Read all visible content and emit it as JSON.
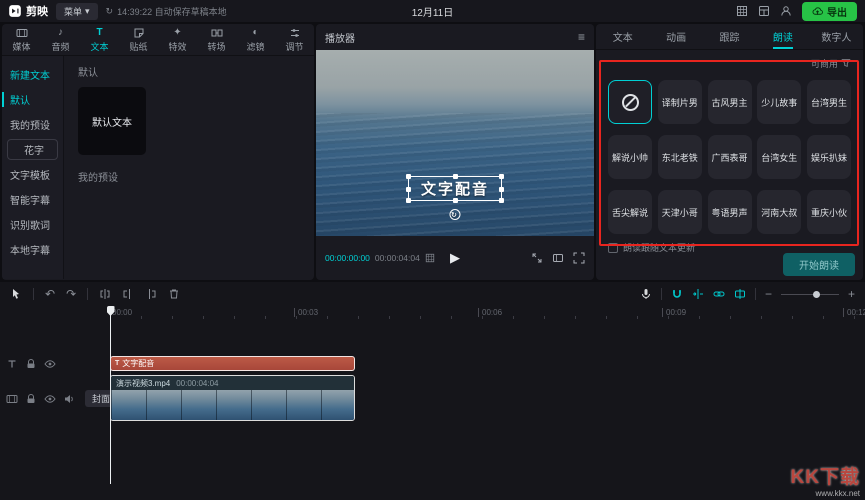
{
  "app": {
    "logo": "剪映",
    "menu_label": "菜单",
    "autosave": "14:39:22 自动保存草稿本地",
    "date": "12月11日",
    "export_label": "导出"
  },
  "left_tabs": [
    {
      "label": "媒体"
    },
    {
      "label": "音频"
    },
    {
      "label": "文本"
    },
    {
      "label": "贴纸"
    },
    {
      "label": "特效"
    },
    {
      "label": "转场"
    },
    {
      "label": "滤镜"
    },
    {
      "label": "调节"
    }
  ],
  "sidebar": {
    "items": [
      {
        "label": "新建文本"
      },
      {
        "label": "默认"
      },
      {
        "label": "我的预设"
      },
      {
        "label": "花字"
      },
      {
        "label": "文字模板"
      },
      {
        "label": "智能字幕"
      },
      {
        "label": "识别歌词"
      },
      {
        "label": "本地字幕"
      }
    ]
  },
  "library": {
    "section_default": "默认",
    "tile_label": "默认文本",
    "section_presets": "我的预设"
  },
  "player": {
    "title": "播放器",
    "overlay_text": "文字配音",
    "current_time": "00:00:00:00",
    "duration": "00:00:04:04"
  },
  "reader": {
    "tabs": [
      {
        "label": "文本"
      },
      {
        "label": "动画"
      },
      {
        "label": "跟踪"
      },
      {
        "label": "朗读"
      },
      {
        "label": "数字人"
      }
    ],
    "filter_label": "可商用",
    "voices": [
      {
        "name": ""
      },
      {
        "name": "译制片男"
      },
      {
        "name": "古风男主"
      },
      {
        "name": "少儿故事"
      },
      {
        "name": "台湾男生"
      },
      {
        "name": "解说小帅"
      },
      {
        "name": "东北老铁"
      },
      {
        "name": "广西表哥"
      },
      {
        "name": "台湾女生"
      },
      {
        "name": "娱乐扒妹"
      },
      {
        "name": "舌尖解说"
      },
      {
        "name": "天津小哥"
      },
      {
        "name": "粤语男声"
      },
      {
        "name": "河南大叔"
      },
      {
        "name": "重庆小伙"
      }
    ],
    "follow_checkbox": "朗读跟随文本更新",
    "start_button": "开始朗读"
  },
  "timeline": {
    "ruler": [
      "00:00",
      "00:03",
      "00:06",
      "00:09",
      "00:12"
    ],
    "text_clip_label": "文字配音",
    "video_clip_name": "演示视频3.mp4",
    "video_clip_duration": "00:00:04:04",
    "cover_button": "封面"
  },
  "watermark": {
    "title": "KK下载",
    "url": "www.kkx.net"
  },
  "colors": {
    "accent": "#00d0d4",
    "export_green": "#27c346",
    "text_clip": "#b2503e",
    "annotation_red": "#e8251f"
  }
}
